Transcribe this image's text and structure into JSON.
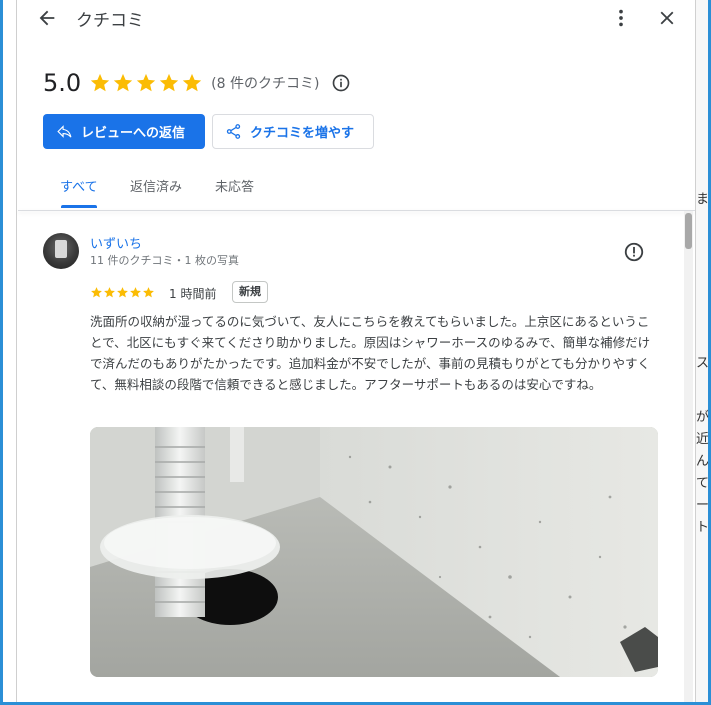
{
  "header": {
    "title": "クチコミ"
  },
  "summary": {
    "rating": "5.0",
    "review_count": "(8 件のクチコミ)"
  },
  "actions": {
    "reply_label": "レビューへの返信",
    "share_label": "クチコミを増やす"
  },
  "tabs": [
    {
      "label": "すべて",
      "active": true
    },
    {
      "label": "返信済み",
      "active": false
    },
    {
      "label": "未応答",
      "active": false
    }
  ],
  "review": {
    "reviewer_name": "いずいち",
    "reviewer_meta": "11 件のクチコミ・1 枚の写真",
    "rating": 5,
    "time": "1 時間前",
    "badge": "新規",
    "text": "洗面所の収納が湿ってるのに気づいて、友人にこちらを教えてもらいました。上京区にあるということで、北区にもすぐ来てくださり助かりました。原因はシャワーホースのゆるみで、簡単な補修だけで済んだのもありがたかったです。追加料金が不安でしたが、事前の見積もりがとても分かりやすくて、無料相談の段階で信頼できると感じました。アフターサポートもあるのは安心ですね。"
  },
  "background_glyphs": [
    "ま",
    "ス",
    "が",
    "近",
    "ん",
    "て",
    "ー",
    "ト"
  ],
  "colors": {
    "accent": "#1a73e8",
    "star": "#fbbc04",
    "frame": "#2b8fd6"
  },
  "icons": [
    "back-arrow-icon",
    "more-vert-icon",
    "close-icon",
    "info-icon",
    "reply-icon",
    "share-icon",
    "report-flag-icon",
    "star-icon"
  ]
}
